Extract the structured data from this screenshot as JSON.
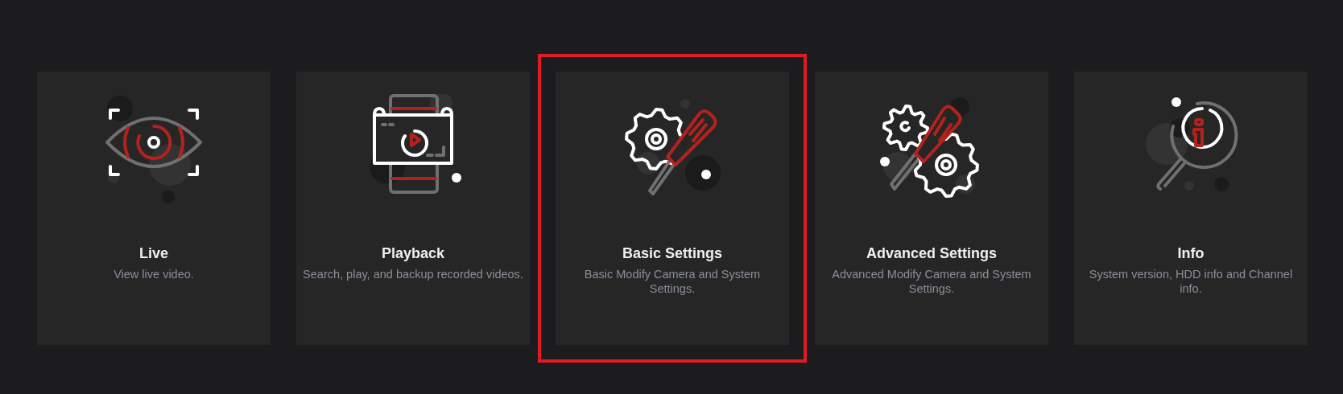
{
  "cards": [
    {
      "kind": "live",
      "title": "Live",
      "description": "View live video.",
      "selected": false
    },
    {
      "kind": "playback",
      "title": "Playback",
      "description": "Search, play, and backup recorded videos.",
      "selected": false
    },
    {
      "kind": "basic",
      "title": "Basic Settings",
      "description": "Basic Modify Camera and System Settings.",
      "selected": true
    },
    {
      "kind": "advanced",
      "title": "Advanced Settings",
      "description": "Advanced Modify Camera and System Settings.",
      "selected": false
    },
    {
      "kind": "info",
      "title": "Info",
      "description": "System version, HDD info and Channel info.",
      "selected": false
    }
  ]
}
